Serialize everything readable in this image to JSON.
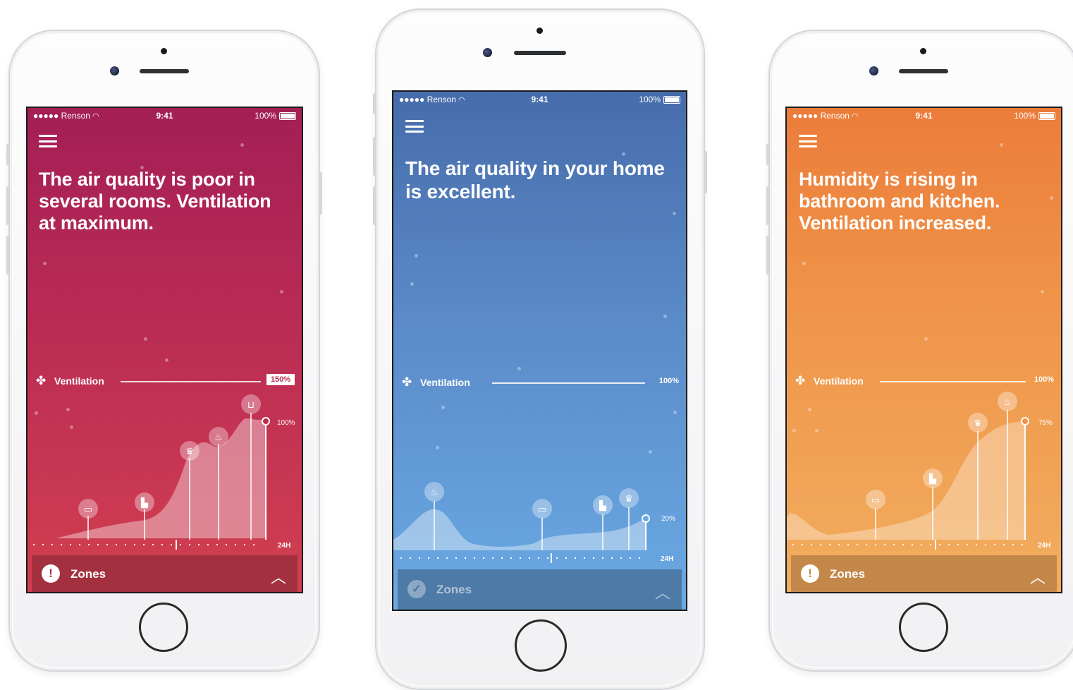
{
  "phones": [
    {
      "theme": "red",
      "status": {
        "carrier": "●●●●● Renson",
        "time": "9:41",
        "battery": "100%"
      },
      "headline": "The air quality is poor in several rooms. Ventilation at maximum.",
      "ventilation": {
        "label": "Ventilation",
        "value": "150%"
      },
      "chart": {
        "level_label": "100%",
        "range_label": "24H",
        "icons": [
          "bed-icon",
          "toilet-icon",
          "chef-hat-icon",
          "bath-icon",
          "sofa-icon"
        ]
      },
      "zones": {
        "label": "Zones",
        "status_icon": "!"
      }
    },
    {
      "theme": "blue",
      "status": {
        "carrier": "●●●●● Renson",
        "time": "9:41",
        "battery": "100%"
      },
      "headline": "The air quality in your home is excellent.",
      "ventilation": {
        "label": "Ventilation",
        "value": "100%"
      },
      "chart": {
        "level_label": "20%",
        "range_label": "24H",
        "icons": [
          "bath-icon",
          "bed-icon",
          "toilet-icon",
          "chef-hat-icon"
        ]
      },
      "zones": {
        "label": "Zones",
        "status_icon": "✓"
      }
    },
    {
      "theme": "orange",
      "status": {
        "carrier": "●●●●● Renson",
        "time": "9:41",
        "battery": "100%"
      },
      "headline": "Humidity is rising in bathroom and kitchen. Ventilation increased.",
      "ventilation": {
        "label": "Ventilation",
        "value": "100%"
      },
      "chart": {
        "level_label": "75%",
        "range_label": "24H",
        "icons": [
          "bed-icon",
          "toilet-icon",
          "chef-hat-icon",
          "bath-icon"
        ]
      },
      "zones": {
        "label": "Zones",
        "status_icon": "!"
      }
    }
  ],
  "icons": {
    "menu": "hamburger-icon",
    "fan": "fan-icon",
    "wifi": "wifi-icon",
    "battery": "battery-icon",
    "chevron": "chevron-up-icon"
  }
}
